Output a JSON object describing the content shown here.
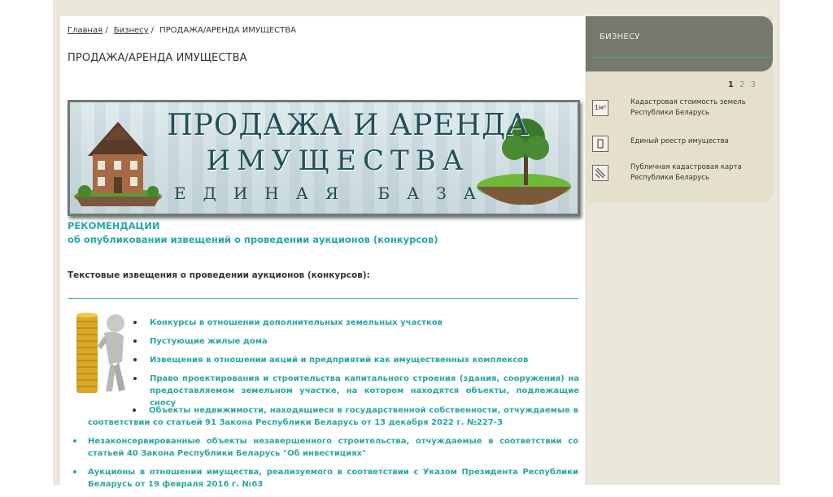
{
  "breadcrumb": {
    "home": "Главная",
    "section": "Бизнесу",
    "current": "ПРОДАЖА/АРЕНДА ИМУЩЕСТВА"
  },
  "page_title": "ПРОДАЖА/АРЕНДА ИМУЩЕСТВА",
  "banner": {
    "line1": "ПРОДАЖА И АРЕНДА",
    "line2": "ИМУЩЕСТВА",
    "line3": "ЕДИНАЯ БАЗА"
  },
  "recommendations": {
    "title": "РЕКОМЕНДАЦИИ",
    "subtitle": "об опубликовании извещений о проведении аукционов (конкурсов)"
  },
  "notices_heading": "Текстовые извещения о проведении аукционов (конкурсов):",
  "links": [
    "Конкурсы в отношении дополнительных земельных участков",
    "Пустующие жилые дома",
    "Извещения в отношении акций и предприятий как имущественных комплексов",
    "Право проектирования и строительства капитального строения (здания, сооружения) на предоставляемом земельном участке, на котором находятся объекты, подлежащие сносу",
    "Объекты недвижимости, находящиеся в государственной собственности, отчуждаемые в соответствии со статьей 91 Закона Республики Беларусь от 13 декабря 2022 г. №227-З",
    "Незаконсервированные объекты  незавершенного строительства, отчуждаемые в соответствии со статьей 40 Закона Республики Беларусь \"Об инвестициях\"",
    "Аукционы в отношении имущества, реализуемого в соответствии с Указом Президента Республики Беларусь от 19 февраля 2016 г. №63"
  ],
  "sidebar": {
    "title": "БИЗНЕСУ",
    "pages": [
      "1",
      "2",
      "3"
    ],
    "items": [
      {
        "icon": "cadastral-value-icon",
        "icon_text": "1м²",
        "label": "Кадастровая стоимость земель Республики Беларусь"
      },
      {
        "icon": "property-register-icon",
        "icon_text": "",
        "label": "Единый реестр имущества"
      },
      {
        "icon": "cadastral-map-icon",
        "icon_text": "",
        "label": "Публичная кадастровая карта Республики Беларусь"
      }
    ]
  },
  "colors": {
    "accent": "#2aa6a5",
    "sidebar_header": "#75786c",
    "page_background": "#ebe7da"
  }
}
